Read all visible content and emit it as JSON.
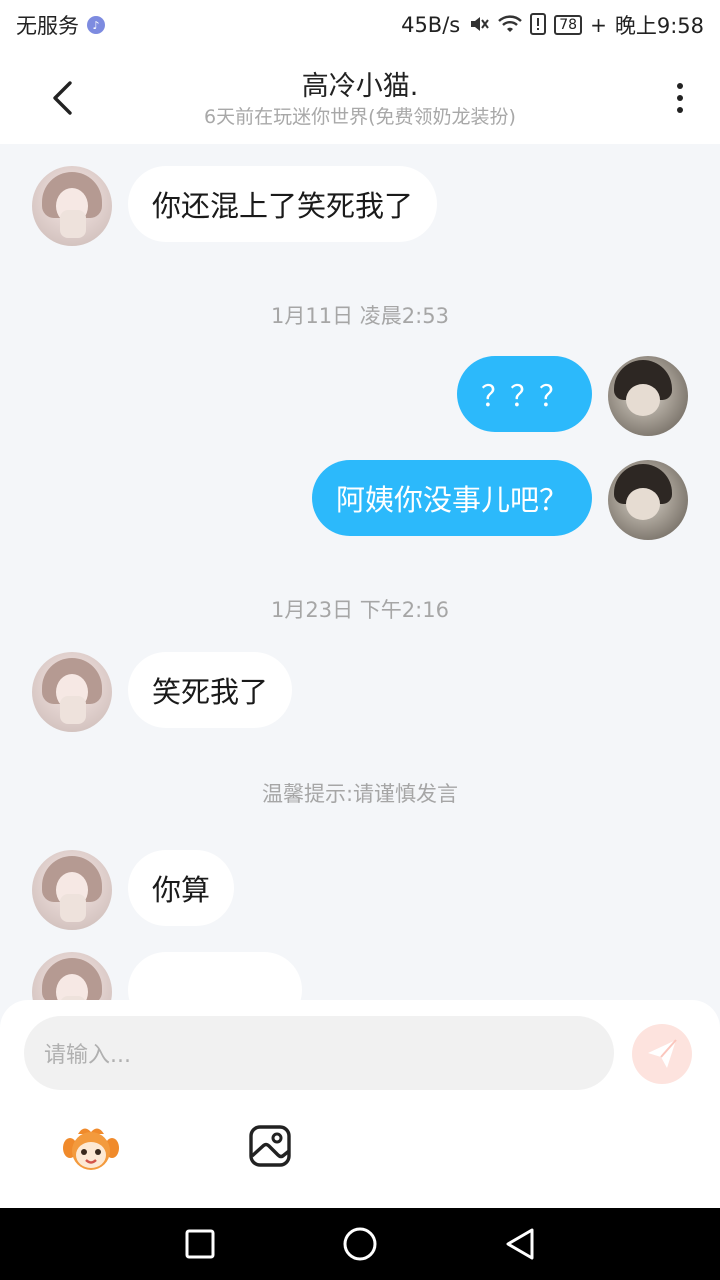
{
  "status_bar": {
    "carrier": "无服务",
    "speed": "45B/s",
    "battery": "78",
    "time": "晚上9:58"
  },
  "header": {
    "title": "高冷小猫.",
    "subtitle": "6天前在玩迷你世界(免费领奶龙装扮)"
  },
  "messages": [
    {
      "side": "left",
      "text": "你还混上了笑死我了"
    },
    {
      "type": "time",
      "text": "1月11日 凌晨2:53"
    },
    {
      "side": "right",
      "text": "？？？"
    },
    {
      "side": "right",
      "text": "阿姨你没事儿吧？"
    },
    {
      "type": "time",
      "text": "1月23日 下午2:16"
    },
    {
      "side": "left",
      "text": "笑死我了"
    },
    {
      "type": "notice",
      "text": "温馨提示:请谨慎发言"
    },
    {
      "side": "left",
      "text": "你算"
    },
    {
      "side": "left",
      "text": ""
    }
  ],
  "input": {
    "placeholder": "请输入..."
  },
  "colors": {
    "accent": "#2cb9fb",
    "background": "#f4f6f9",
    "send_button": "#fde3de"
  },
  "icons": [
    "back-icon",
    "more-icon",
    "send-icon",
    "mascot-icon",
    "image-icon",
    "square-nav-icon",
    "circle-nav-icon",
    "triangle-nav-icon"
  ]
}
